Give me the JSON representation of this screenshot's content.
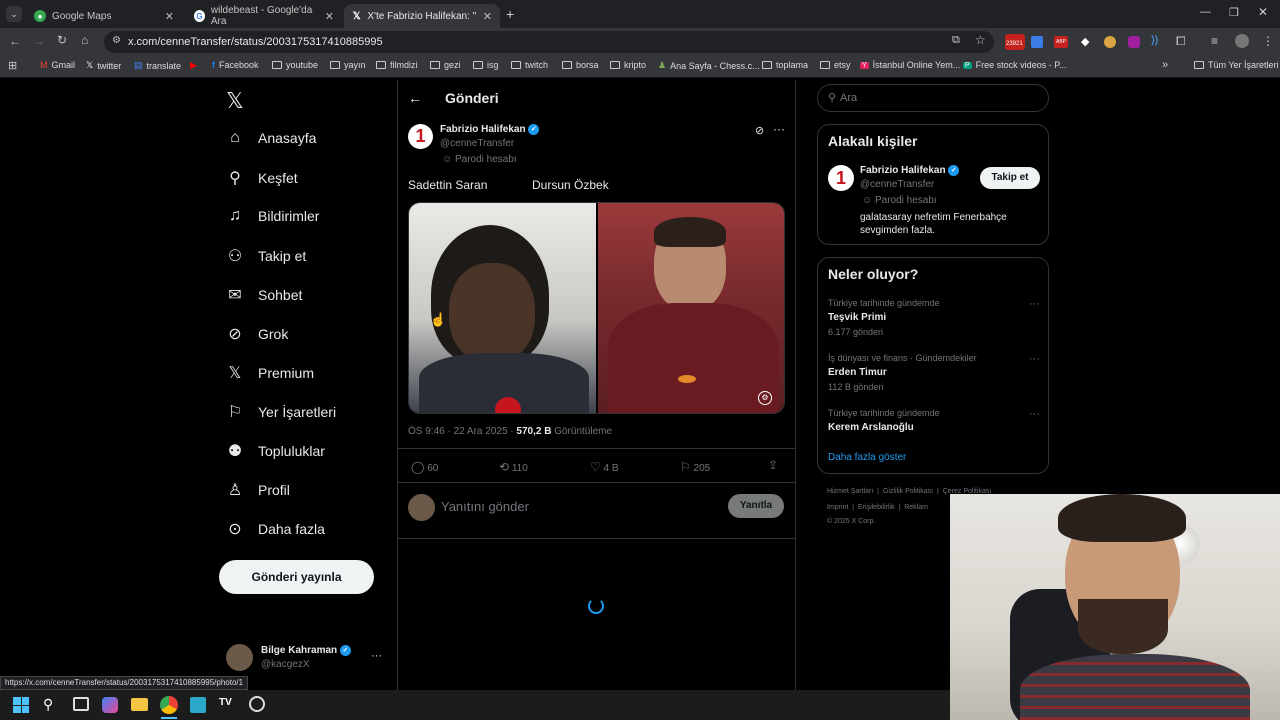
{
  "browser": {
    "tabs": [
      {
        "label": "Google Maps"
      },
      {
        "label": "wildebeast - Google'da Ara"
      },
      {
        "label": "X'te Fabrizio Halifekan: \"Sadetti"
      }
    ],
    "url": "x.com/cenneTransfer/status/2003175317410885995",
    "bookmarks": [
      "Gmail",
      "twitter",
      "translate",
      "Facebook",
      "youtube",
      "yayın",
      "filmdizi",
      "gezi",
      "isg",
      "twitch",
      "borsa",
      "kripto",
      "Ana Sayfa - Chess.c...",
      "toplama",
      "etsy",
      "İstanbul Online Yem...",
      "Free stock videos - P..."
    ],
    "all_bookmarks": "Tüm Yer İşaretleri",
    "ext_badge": "23921",
    "status_url": "https://x.com/cenneTransfer/status/2003175317410885995/photo/1"
  },
  "nav": {
    "items": [
      "Anasayfa",
      "Keşfet",
      "Bildirimler",
      "Takip et",
      "Sohbet",
      "Grok",
      "Premium",
      "Yer İşaretleri",
      "Topluluklar",
      "Profil",
      "Daha fazla"
    ],
    "post_button": "Gönderi yayınla",
    "account": {
      "name": "Bilge Kahraman",
      "handle": "@kacgezX",
      "more": "···"
    }
  },
  "post": {
    "header": "Gönderi",
    "author": {
      "name": "Fabrizio Halifekan",
      "handle": "@cenneTransfer",
      "label": "Parodi hesabı",
      "avatar_text": "1"
    },
    "text_left": "Sadettin Saran",
    "text_right": "Dursun Özbek",
    "time": "ÖS 9:46 · 22 Ara 2025 · ",
    "views": "570,2 B",
    "views_label": " Görüntüleme",
    "stats": {
      "replies": "60",
      "reposts": "110",
      "likes": "4 B",
      "bookmarks": "205"
    },
    "reply_placeholder": "Yanıtını gönder",
    "reply_button": "Yanıtla"
  },
  "sidebar": {
    "search_placeholder": "Ara",
    "related": {
      "title": "Alakalı kişiler",
      "name": "Fabrizio Halifekan",
      "handle": "@cenneTransfer",
      "label": "Parodi hesabı",
      "bio": "galatasaray nefretim Fenerbahçe sevgimden fazla.",
      "follow": "Takip et"
    },
    "trends": {
      "title": "Neler oluyor?",
      "items": [
        {
          "context": "Türkiye tarihinde gündemde",
          "name": "Teşvik Primi",
          "count": "6.177 gönderi"
        },
        {
          "context": "İş dünyası ve finans · Gündemdekiler",
          "name": "Erden Timur",
          "count": "112 B gönderi"
        },
        {
          "context": "Türkiye tarihinde gündemde",
          "name": "Kerem Arslanoğlu",
          "count": ""
        }
      ],
      "more": "Daha fazla göster"
    },
    "footer": [
      "Hizmet Şartları",
      "Gizlilik Politikası",
      "Çerez Politikası",
      "Imprint",
      "Erişilebilirlik",
      "Reklam",
      "© 2025 X Corp."
    ]
  }
}
